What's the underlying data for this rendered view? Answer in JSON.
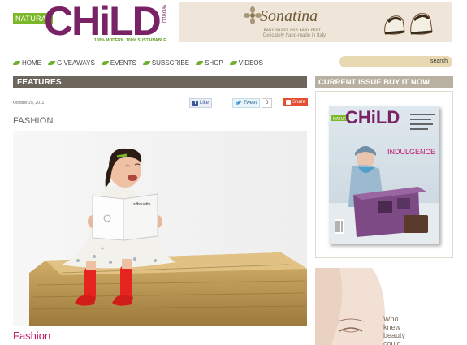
{
  "logo": {
    "badge": "NATURAL",
    "word": "CHiLD",
    "world": "WORLD",
    "tagline": "100% MODERN. 100% SUSTAINABLE."
  },
  "ad": {
    "brand": "Sonatina",
    "sub": "BABY SHOES FOR BABY FEET",
    "desc": "Delicately hand-made in Italy"
  },
  "nav": {
    "items": [
      {
        "label": "HOME"
      },
      {
        "label": "GIVEAWAYS"
      },
      {
        "label": "EVENTS"
      },
      {
        "label": "SUBSCRIBE"
      },
      {
        "label": "SHOP"
      },
      {
        "label": "VIDEOS"
      }
    ]
  },
  "search": {
    "label": "search"
  },
  "features": {
    "title": "FEATURES"
  },
  "post": {
    "date": "October 25, 2011",
    "fb_like": "Like",
    "tweet": "Tweet",
    "tweet_count": "0",
    "share": "Share",
    "title": "FASHION",
    "caption": "Fashion",
    "book_label": "silhouette"
  },
  "sidebar": {
    "current_title": "CURRENT ISSUE BUY IT NOW",
    "cover": {
      "badge": "NATURAL",
      "word": "CHiLD",
      "headline": "INDULGENCE"
    },
    "ad_copy": [
      "Who",
      "knew",
      "beauty",
      "could"
    ]
  },
  "colors": {
    "brand_purple": "#7a2266",
    "brand_green": "#7ab828",
    "caption_pink": "#c0166a",
    "bar_dark": "#6d665c",
    "bar_light": "#b8b0a0"
  }
}
